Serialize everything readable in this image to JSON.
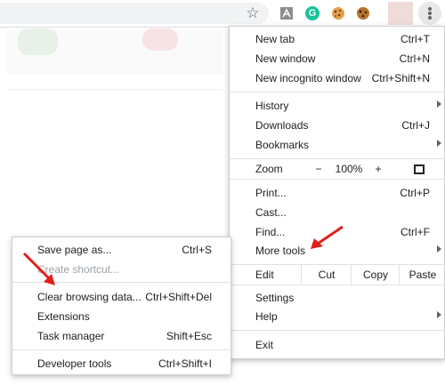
{
  "toolbar": {
    "extensions": [
      "bookmark-star-icon",
      "pdf-extension-icon",
      "grammarly-extension-icon",
      "cookie-extension-icon",
      "cookie-editor-extension-icon"
    ],
    "grammarly_letter": "G"
  },
  "main_menu": {
    "new_tab": {
      "label": "New tab",
      "shortcut": "Ctrl+T"
    },
    "new_window": {
      "label": "New window",
      "shortcut": "Ctrl+N"
    },
    "new_incognito": {
      "label": "New incognito window",
      "shortcut": "Ctrl+Shift+N"
    },
    "history": {
      "label": "History"
    },
    "downloads": {
      "label": "Downloads",
      "shortcut": "Ctrl+J"
    },
    "bookmarks": {
      "label": "Bookmarks"
    },
    "zoom": {
      "label": "Zoom",
      "minus": "−",
      "value": "100%",
      "plus": "+"
    },
    "print": {
      "label": "Print...",
      "shortcut": "Ctrl+P"
    },
    "cast": {
      "label": "Cast..."
    },
    "find": {
      "label": "Find...",
      "shortcut": "Ctrl+F"
    },
    "more_tools": {
      "label": "More tools"
    },
    "edit": {
      "label": "Edit",
      "cut": "Cut",
      "copy": "Copy",
      "paste": "Paste"
    },
    "settings": {
      "label": "Settings"
    },
    "help": {
      "label": "Help"
    },
    "exit": {
      "label": "Exit"
    }
  },
  "more_tools_menu": {
    "save_page": {
      "label": "Save page as...",
      "shortcut": "Ctrl+S"
    },
    "create_shortcut": {
      "label": "Create shortcut..."
    },
    "clear_browsing": {
      "label": "Clear browsing data...",
      "shortcut": "Ctrl+Shift+Del"
    },
    "extensions": {
      "label": "Extensions"
    },
    "task_manager": {
      "label": "Task manager",
      "shortcut": "Shift+Esc"
    },
    "developer_tools": {
      "label": "Developer tools",
      "shortcut": "Ctrl+Shift+I"
    }
  },
  "colors": {
    "annotation_arrow": "#e0201b",
    "grammarly": "#15c39a",
    "menu_text": "#202124",
    "disabled_text": "#9aa0a6"
  }
}
